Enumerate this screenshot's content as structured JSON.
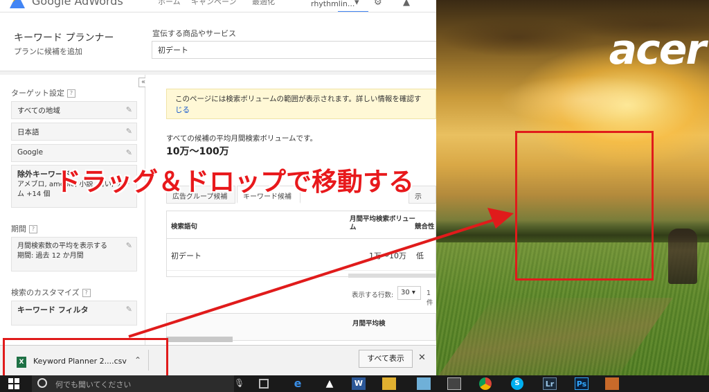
{
  "topbar": {
    "app_name": "Google AdWords",
    "nav_home": "ホーム",
    "nav_campaigns": "キャンペーン",
    "nav_optimize": "最適化",
    "user": "rhythmlin..."
  },
  "planner": {
    "title": "キーワード プランナー",
    "subtitle": "プランに候補を追加",
    "product_label": "宣伝する商品やサービス",
    "product_value": "初デート"
  },
  "sidebar": {
    "targeting_title": "ターゲット設定",
    "help": "?",
    "location": "すべての地域",
    "language": "日本語",
    "network": "Google",
    "negative_title": "除外キーワード",
    "negative_desc": "アメブロ, ameblo, 小説, 占い, ゲーム +14 個",
    "period_title": "期間",
    "period_desc": "月間検索数の平均を表示する",
    "period_range": "期間: 過去 12 か月間",
    "customize_title": "検索のカスタマイズ",
    "keyword_filter": "キーワード フィルタ"
  },
  "main": {
    "notice": "このページには検索ボリュームの範囲が表示されます。詳しい情報を確認す",
    "notice_link": "じる",
    "avg_label": "すべての候補の平均月間検索ボリュームです。",
    "avg_value": "10万～100万",
    "tab_adgroup": "広告グループ候補",
    "tab_keyword": "キーワード候補",
    "tab_other": "示",
    "col_term": "検索語句",
    "col_volume": "月間平均検索ボリューム",
    "col_competition": "競合性",
    "row_term": "初デート",
    "row_volume": "1万～10万",
    "row_competition": "低",
    "rows_label": "表示する行数:",
    "rows_value": "30",
    "page_num": "1 件",
    "col_volume2": "月間平均検"
  },
  "downloads": {
    "file_name": "Keyword Planner 2....csv",
    "file_icon": "X",
    "show_all": "すべて表示",
    "close": "✕"
  },
  "annotation": {
    "text": "ドラッグ＆ドロップで移動する"
  },
  "desktop": {
    "brand": "acer"
  },
  "taskbar": {
    "search_placeholder": "何でも聞いてください",
    "icons": [
      "W",
      "Lr",
      "Ps"
    ]
  },
  "colors": {
    "annotation_red": "#e8191c",
    "highlight_red": "#e01b1b",
    "notice_bg": "#fff8d6",
    "link_blue": "#1155cc"
  }
}
